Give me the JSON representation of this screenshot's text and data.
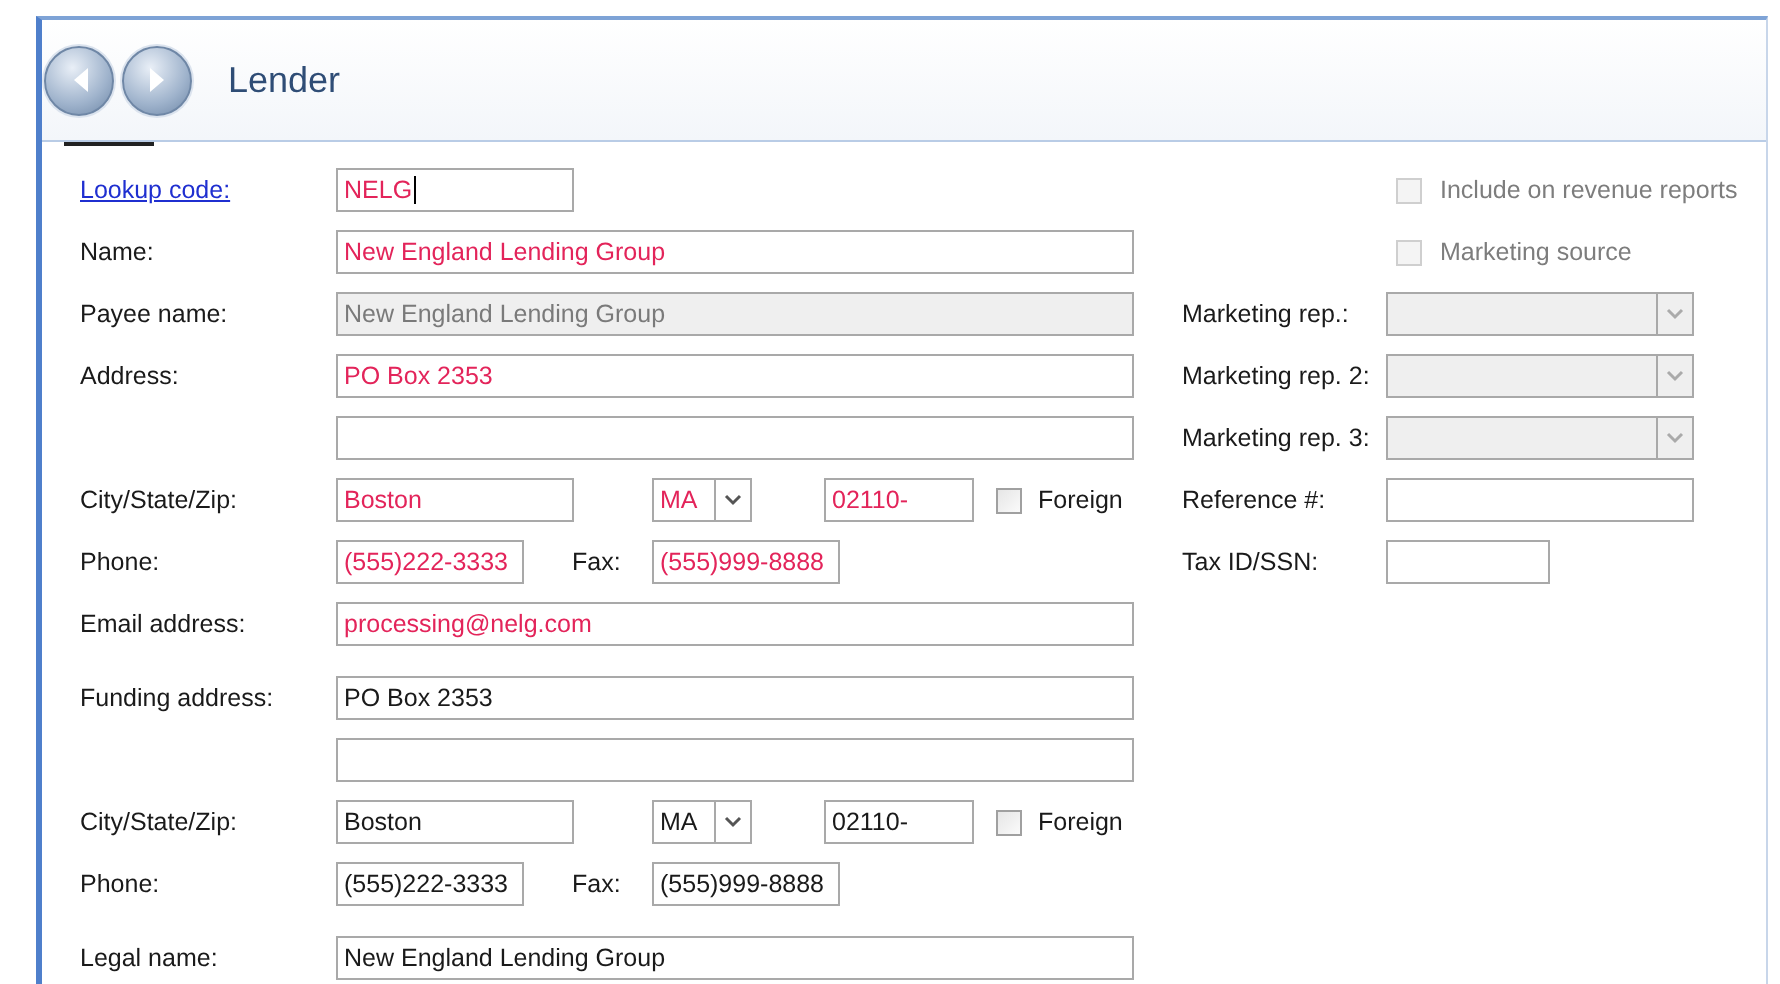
{
  "header": {
    "title": "Lender",
    "nav": [
      {
        "kind": "back"
      },
      {
        "kind": "forward"
      }
    ]
  },
  "left_groups": [
    [
      {
        "kind": "code",
        "label": "Lookup code:",
        "label_link": true,
        "value": "NELG",
        "required": true,
        "focused": true
      },
      {
        "kind": "text",
        "label": "Name:",
        "value": "New England Lending Group",
        "required": true
      },
      {
        "kind": "text",
        "label": "Payee name:",
        "value": "New England Lending Group",
        "disabled": true
      },
      {
        "kind": "text",
        "label": "Address:",
        "value": "PO Box 2353",
        "required": true
      },
      {
        "kind": "text"
      },
      {
        "kind": "city_state_zip",
        "label": "City/State/Zip:",
        "city": "Boston",
        "state": "MA",
        "zip": "02110-",
        "foreign_label": "Foreign",
        "foreign_checked": false,
        "required": true
      },
      {
        "kind": "phone_fax",
        "label": "Phone:",
        "phone": "(555)222-3333",
        "fax_label": "Fax:",
        "fax": "(555)999-8888",
        "required": true
      },
      {
        "kind": "text",
        "label": "Email address:",
        "value": "processing@nelg.com",
        "required": true
      }
    ],
    [
      {
        "kind": "text",
        "label": "Funding address:",
        "value": "PO Box 2353",
        "required": false
      },
      {
        "kind": "text"
      },
      {
        "kind": "city_state_zip",
        "label": "City/State/Zip:",
        "city": "Boston",
        "state": "MA",
        "zip": "02110-",
        "foreign_label": "Foreign",
        "foreign_checked": false,
        "required": false
      },
      {
        "kind": "phone_fax",
        "label": "Phone:",
        "phone": "(555)222-3333",
        "fax_label": "Fax:",
        "fax": "(555)999-8888",
        "required": false
      }
    ],
    [
      {
        "kind": "text",
        "label": "Legal name:",
        "value": "New England Lending Group",
        "required": false
      }
    ]
  ],
  "right_rows": [
    {
      "kind": "checkbox",
      "label": "Include on revenue reports",
      "checked": false,
      "disabled": true
    },
    {
      "kind": "checkbox",
      "label": "Marketing source",
      "checked": false,
      "disabled": true
    },
    {
      "kind": "select",
      "label": "Marketing rep.:",
      "disabled": true
    },
    {
      "kind": "select",
      "label": "Marketing rep. 2:",
      "disabled": true
    },
    {
      "kind": "select",
      "label": "Marketing rep. 3:",
      "disabled": true
    },
    {
      "kind": "text",
      "label": "Reference #:"
    },
    {
      "kind": "short",
      "label": "Tax ID/SSN:"
    }
  ]
}
